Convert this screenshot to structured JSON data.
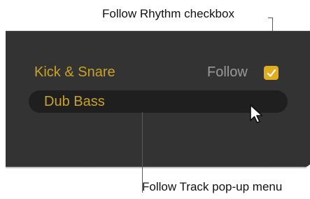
{
  "callouts": {
    "follow_rhythm": "Follow Rhythm checkbox",
    "follow_track": "Follow Track pop-up menu"
  },
  "panel": {
    "track_name": "Kick & Snare",
    "follow_label": "Follow",
    "follow_checkbox_checked": true,
    "popup_value": "Dub Bass"
  },
  "colors": {
    "panel_bg": "#333333",
    "popup_bg": "#1f1f1f",
    "accent_text": "#c9a227",
    "checkbox_fill": "#e0ad1f",
    "muted_text": "#9a9a9a"
  },
  "icons": {
    "checkmark": "checkmark-icon",
    "cursor": "mouse-pointer-icon"
  }
}
